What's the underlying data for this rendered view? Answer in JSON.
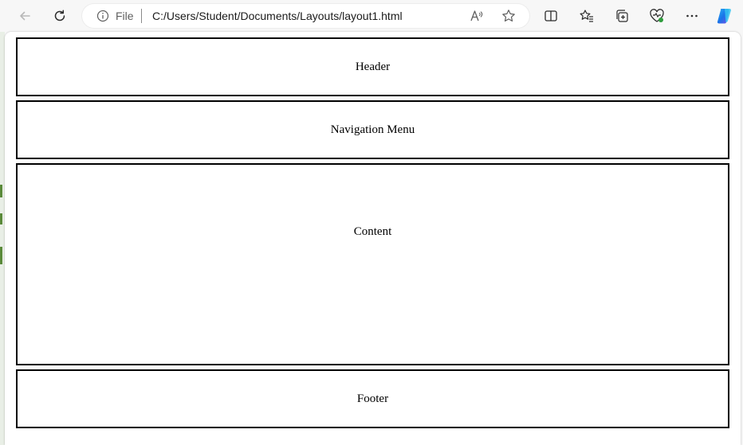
{
  "browser": {
    "address": {
      "scheme_label": "File",
      "url": "C:/Users/Student/Documents/Layouts/layout1.html"
    },
    "icons": [
      "back-icon",
      "refresh-icon",
      "info-icon",
      "read-aloud-icon",
      "favorite-star-icon",
      "split-screen-icon",
      "favorites-icon",
      "collections-icon",
      "browser-essentials-icon",
      "more-icon",
      "copilot-icon"
    ]
  },
  "page": {
    "header": "Header",
    "nav": "Navigation Menu",
    "content": "Content",
    "footer": "Footer"
  },
  "colors": {
    "toolbar_bg": "#f7f7f7",
    "box_border": "#000000",
    "copilot_blue": "#1a73e8"
  }
}
